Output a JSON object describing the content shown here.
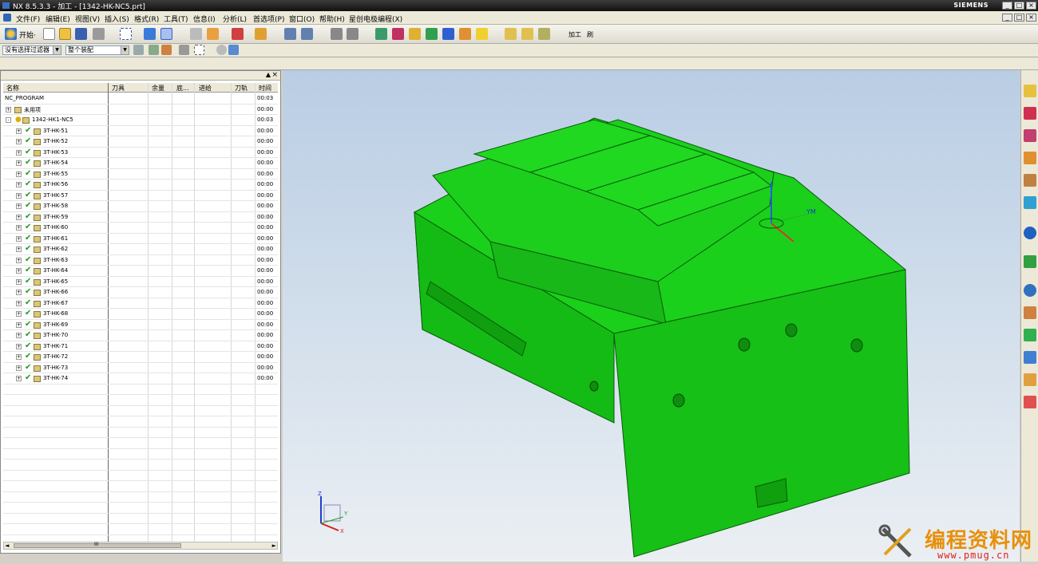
{
  "window": {
    "title": "NX 8.5.3.3 - 加工 - [1342-HK-NC5.prt]",
    "brand": "SIEMENS",
    "controls": [
      "_",
      "□",
      "×"
    ],
    "doc_controls": [
      "_",
      "□",
      "×"
    ]
  },
  "menu": [
    "文件(F)",
    "编辑(E)",
    "视图(V)",
    "插入(S)",
    "格式(R)",
    "工具(T)",
    "信息(I)",
    "分析(L)",
    "首选项(P)",
    "窗口(O)",
    "帮助(H)",
    "星创电极编程(X)"
  ],
  "toolbar": {
    "start_label": "开始·",
    "part1_label": "加工",
    "part2_label": "刷"
  },
  "filters": {
    "selection_filter": "没有选择过滤器",
    "assembly_scope": "整个装配"
  },
  "navigator": {
    "columns": [
      "名称",
      "刀具",
      "余量",
      "底...",
      "进给",
      "刀轨",
      "时间"
    ],
    "root": {
      "name": "NC_PROGRAM",
      "time": "00:03"
    },
    "unused": {
      "name": "未用项",
      "time": "00:00"
    },
    "program": {
      "name": "1342-HK1-NC5",
      "time": "00:03"
    },
    "operations": [
      {
        "name": "3T-HK-51",
        "time": "00:00"
      },
      {
        "name": "3T-HK-52",
        "time": "00:00"
      },
      {
        "name": "3T-HK-53",
        "time": "00:00"
      },
      {
        "name": "3T-HK-54",
        "time": "00:00"
      },
      {
        "name": "3T-HK-55",
        "time": "00:00"
      },
      {
        "name": "3T-HK-56",
        "time": "00:00"
      },
      {
        "name": "3T-HK-57",
        "time": "00:00"
      },
      {
        "name": "3T-HK-58",
        "time": "00:00"
      },
      {
        "name": "3T-HK-59",
        "time": "00:00"
      },
      {
        "name": "3T-HK-60",
        "time": "00:00"
      },
      {
        "name": "3T-HK-61",
        "time": "00:00"
      },
      {
        "name": "3T-HK-62",
        "time": "00:00"
      },
      {
        "name": "3T-HK-63",
        "time": "00:00"
      },
      {
        "name": "3T-HK-64",
        "time": "00:00"
      },
      {
        "name": "3T-HK-65",
        "time": "00:00"
      },
      {
        "name": "3T-HK-66",
        "time": "00:00"
      },
      {
        "name": "3T-HK-67",
        "time": "00:00"
      },
      {
        "name": "3T-HK-68",
        "time": "00:00"
      },
      {
        "name": "3T-HK-69",
        "time": "00:00"
      },
      {
        "name": "3T-HK-70",
        "time": "00:00"
      },
      {
        "name": "3T-HK-71",
        "time": "00:00"
      },
      {
        "name": "3T-HK-72",
        "time": "00:00"
      },
      {
        "name": "3T-HK-73",
        "time": "00:00"
      },
      {
        "name": "3T-HK-74",
        "time": "00:00"
      }
    ],
    "scroll_mark": "III"
  },
  "viewport": {
    "wcs_label": "YM",
    "triad": {
      "z": "Z",
      "y": "Y",
      "x": "X"
    },
    "model_color": "#19c619"
  },
  "watermark": {
    "title": "编程资料网",
    "url": "www.pmug.cn"
  }
}
